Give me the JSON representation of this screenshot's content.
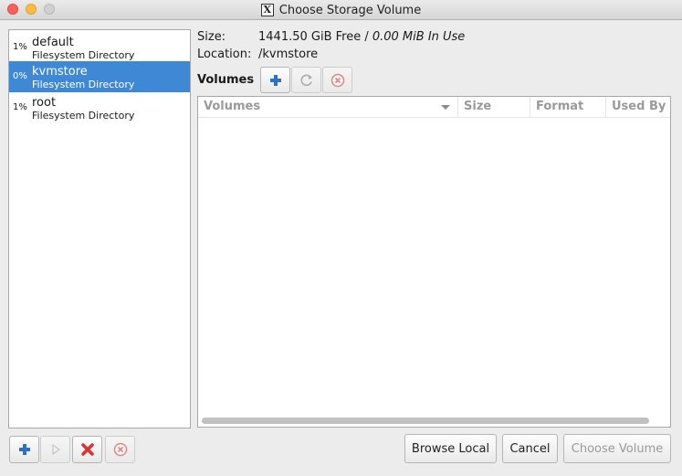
{
  "window": {
    "title": "Choose Storage Volume"
  },
  "pools": [
    {
      "pct": "1%",
      "name": "default",
      "type": "Filesystem Directory",
      "selected": false
    },
    {
      "pct": "0%",
      "name": "kvmstore",
      "type": "Filesystem Directory",
      "selected": true
    },
    {
      "pct": "1%",
      "name": "root",
      "type": "Filesystem Directory",
      "selected": false
    }
  ],
  "info": {
    "size_label": "Size:",
    "size_free": "1441.50 GiB Free / ",
    "size_inuse": "0.00 MiB In Use",
    "location_label": "Location:",
    "location_value": "/kvmstore"
  },
  "volumes_section": {
    "label": "Volumes"
  },
  "volumes_table": {
    "columns": [
      "Volumes",
      "Size",
      "Format",
      "Used By"
    ],
    "rows": []
  },
  "buttons": {
    "browse_local": "Browse Local",
    "cancel": "Cancel",
    "choose_volume": "Choose Volume"
  },
  "colors": {
    "selection": "#3f88d6",
    "add_icon": "#2f6fc4",
    "delete_icon": "#e03030"
  }
}
